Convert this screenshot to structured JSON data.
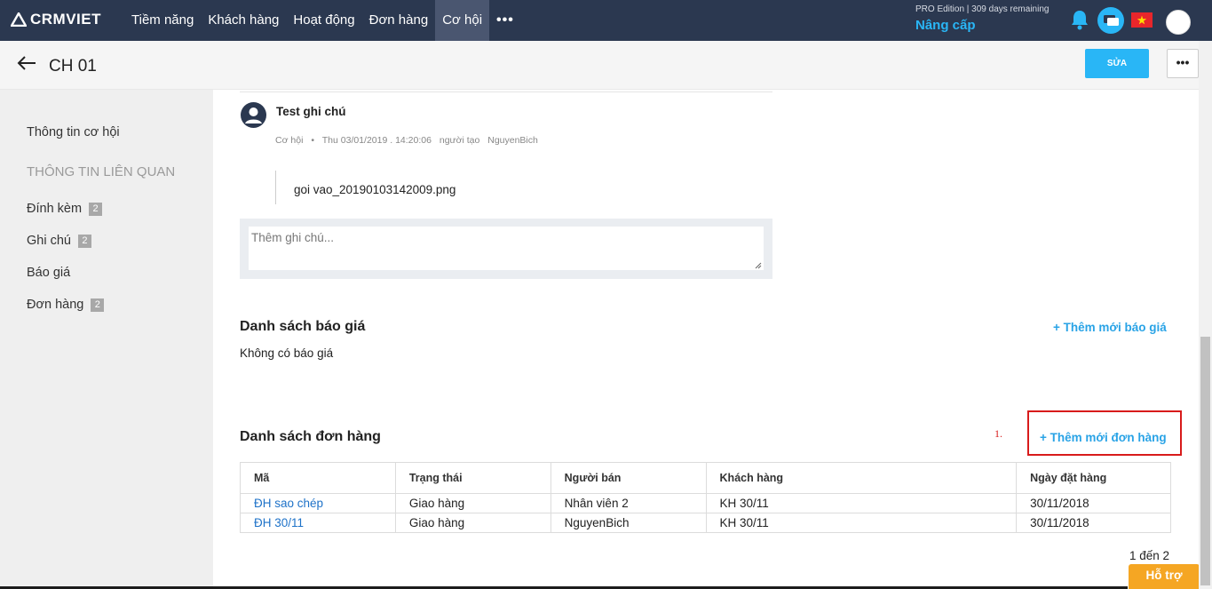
{
  "topnav": {
    "logo": "CRMVIET",
    "menu": [
      "Tiềm năng",
      "Khách hàng",
      "Hoạt động",
      "Đơn hàng",
      "Cơ hội"
    ],
    "more": "•••",
    "edition": "PRO Edition | 309 days remaining",
    "upgrade": "Nâng cấp",
    "icons": [
      "bell-icon",
      "chat-icon",
      "vietnam-flag-icon",
      "user-avatar"
    ]
  },
  "header": {
    "title": "CH 01",
    "edit_label": "SỬA",
    "more_label": "•••"
  },
  "sidebar": {
    "info": "Thông tin cơ hội",
    "related_heading": "THÔNG TIN LIÊN QUAN",
    "items": [
      {
        "label": "Đính kèm",
        "badge": "2"
      },
      {
        "label": "Ghi chú",
        "badge": "2"
      },
      {
        "label": "Báo giá"
      },
      {
        "label": "Đơn hàng",
        "badge": "2"
      }
    ]
  },
  "note": {
    "title": "Test ghi chú",
    "type": "Cơ hội",
    "bullet": "•",
    "datetime": "Thu 03/01/2019 . 14:20:06",
    "creator_label": "người tạo",
    "creator": "NguyenBich",
    "attachment": "goi vao_20190103142009.png",
    "input_placeholder": "Thêm ghi chú..."
  },
  "quotes": {
    "title": "Danh sách báo giá",
    "add_label": "+ Thêm mới báo giá",
    "empty": "Không có báo giá"
  },
  "orders": {
    "title": "Danh sách đơn hàng",
    "add_label": "+ Thêm mới đơn hàng",
    "annotation": "1.",
    "columns": [
      "Mã",
      "Trạng thái",
      "Người bán",
      "Khách hàng",
      "Ngày đặt hàng"
    ],
    "rows": [
      {
        "code": "ĐH sao chép",
        "status": "Giao hàng",
        "seller": "Nhân viên 2",
        "customer": "KH 30/11",
        "date": "30/11/2018"
      },
      {
        "code": "ĐH 30/11",
        "status": "Giao hàng",
        "seller": "NguyenBich",
        "customer": "KH 30/11",
        "date": "30/11/2018"
      }
    ],
    "pager": "1 đến 2"
  },
  "support_label": "Hỗ trợ",
  "colors": {
    "nav_bg": "#2b3850",
    "accent": "#29b6f6",
    "link": "#1e72c8",
    "annotation": "#d81b1b",
    "support": "#f5a623"
  }
}
